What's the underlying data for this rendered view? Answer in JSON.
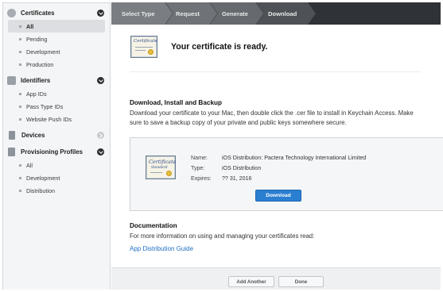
{
  "sidebar": {
    "certificates": {
      "label": "Certificates",
      "items": [
        "All",
        "Pending",
        "Development",
        "Production"
      ]
    },
    "identifiers": {
      "label": "Identifiers",
      "items": [
        "App IDs",
        "Pass Type IDs",
        "Website Push IDs"
      ]
    },
    "devices": {
      "label": "Devices"
    },
    "profiles": {
      "label": "Provisioning Profiles",
      "items": [
        "All",
        "Development",
        "Distribution"
      ]
    }
  },
  "steps": [
    "Select Type",
    "Request",
    "Generate",
    "Download"
  ],
  "ready": {
    "title": "Your certificate is ready."
  },
  "cert_icon_text": "Certificate",
  "cert_icon_text_2": "Standard",
  "download_section": {
    "title": "Download, Install and Backup",
    "description": "Download your certificate to your Mac, then double click the .cer file to install in Keychain Access. Make sure to save a backup copy of your private and public keys somewhere secure."
  },
  "certificate": {
    "name_label": "Name:",
    "name": "iOS Distribution: Pactera Technology International Limited",
    "type_label": "Type:",
    "type": "iOS Distribution",
    "expires_label": "Expires:",
    "expires": "?? 31, 2016",
    "download_label": "Download"
  },
  "documentation": {
    "title": "Documentation",
    "description": "For more information on using and managing your certificates read:",
    "link": "App Distribution Guide"
  },
  "footer": {
    "add_another": "Add Another",
    "done": "Done"
  },
  "colors": {
    "accent": "#2b7fd0",
    "link": "#1f6fc4",
    "steps_bar": "#2f3236"
  }
}
